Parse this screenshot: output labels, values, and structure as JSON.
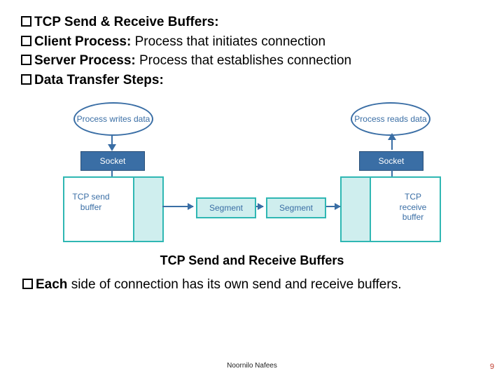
{
  "bullets": {
    "l1_bold": "TCP Send & Receive Buffers:",
    "l2_bold": "Client Process: ",
    "l2_rest": "Process that initiates connection",
    "l3_bold": "Server Process: ",
    "l3_rest": "Process that establishes connection",
    "l4_bold": "Data Transfer Steps:"
  },
  "diagram": {
    "proc_left": "Process writes data",
    "proc_right": "Process reads data",
    "socket": "Socket",
    "send_buf": "TCP send buffer",
    "recv_buf": "TCP receive buffer",
    "segment": "Segment"
  },
  "caption": "TCP Send and Receive Buffers",
  "closing": {
    "bold": "Each",
    "rest": " side of connection has its own send and receive buffers."
  },
  "footer": {
    "author": "Noornilo Nafees",
    "page": "9"
  }
}
